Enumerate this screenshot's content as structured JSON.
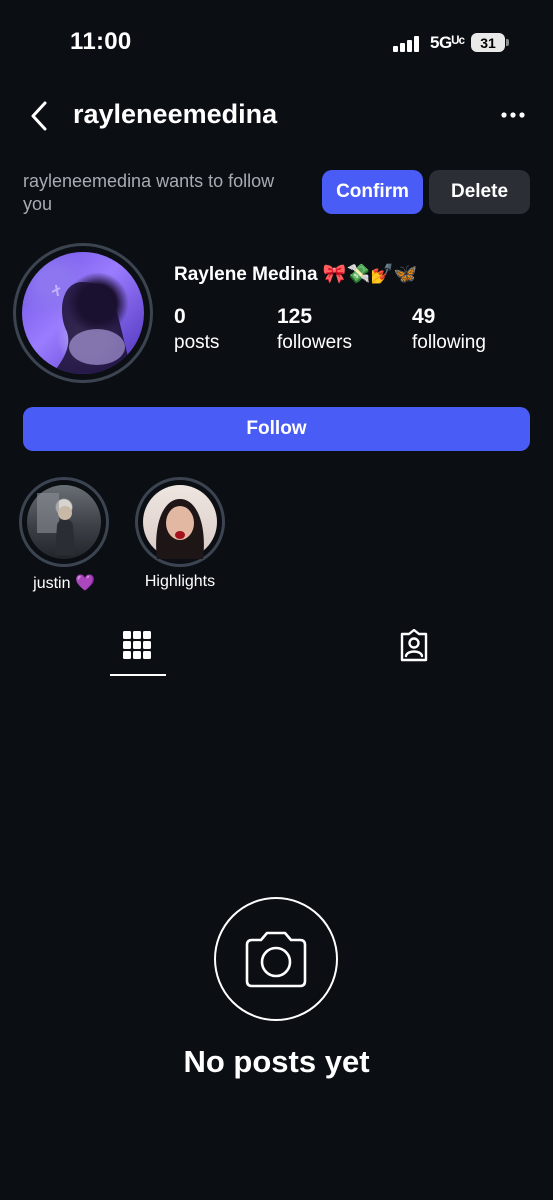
{
  "status_bar": {
    "time": "11:00",
    "network": "5Gᵁᶜ",
    "battery": "31"
  },
  "header": {
    "username": "rayleneemedina",
    "back_icon": "chevron-left-icon",
    "more_icon": "more-horizontal-icon"
  },
  "follow_request": {
    "text": "rayleneemedina wants to follow you",
    "confirm_label": "Confirm",
    "delete_label": "Delete",
    "confirm_color": "#4a5cf6"
  },
  "profile": {
    "display_name": "Raylene Medina 🎀💸💅🦋",
    "stats": [
      {
        "value": "0",
        "label": "posts"
      },
      {
        "value": "125",
        "label": "followers"
      },
      {
        "value": "49",
        "label": "following"
      }
    ],
    "follow_label": "Follow"
  },
  "highlights": [
    {
      "label": "justin 💜"
    },
    {
      "label": "Highlights"
    }
  ],
  "tabs": [
    {
      "icon": "grid-icon",
      "active": true
    },
    {
      "icon": "tagged-person-icon",
      "active": false
    }
  ],
  "empty_state": {
    "icon": "camera-icon",
    "title": "No posts yet"
  }
}
